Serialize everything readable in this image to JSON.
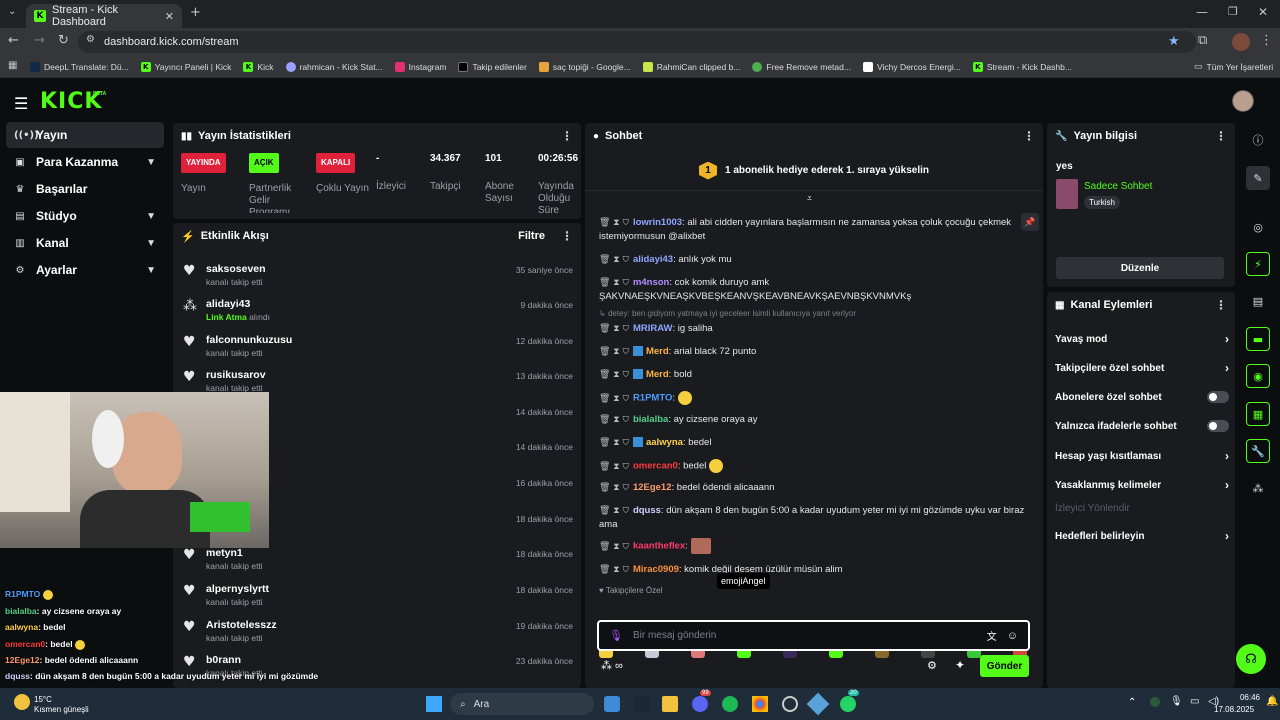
{
  "browser": {
    "tab_title": "Stream - Kick Dashboard",
    "url": "dashboard.kick.com/stream",
    "bookmarks": [
      "DeepL Translate: Dü...",
      "Yayıncı Paneli | Kick",
      "Kick",
      "rahmican - Kick Stat...",
      "Instagram",
      "Takip edilenler",
      "saç topiği - Google...",
      "RahmiCan clipped b...",
      "Free Remove metad...",
      "Vichy Dercos Energi...",
      "Stream - Kick Dashb..."
    ],
    "all_bookmarks": "Tüm Yer İşaretleri"
  },
  "logo": "KICK",
  "logo_sup": "BETA",
  "sidebar": {
    "items": [
      {
        "label": "Yayın",
        "icon": "broadcast-icon"
      },
      {
        "label": "Para Kazanma",
        "icon": "wallet-icon"
      },
      {
        "label": "Başarılar",
        "icon": "trophy-icon"
      },
      {
        "label": "Stüdyo",
        "icon": "studio-icon"
      },
      {
        "label": "Kanal",
        "icon": "channel-icon"
      },
      {
        "label": "Ayarlar",
        "icon": "gear-icon"
      }
    ]
  },
  "stats": {
    "title": "Yayın İstatistikleri",
    "items": [
      {
        "badge": "YAYINDA",
        "label": "Yayın"
      },
      {
        "badge": "AÇIK",
        "label": "Partnerlik Gelir Programı"
      },
      {
        "badge": "KAPALI",
        "label": "Çoklu Yayın"
      },
      {
        "value": "-",
        "label": "İzleyici"
      },
      {
        "value": "34.367",
        "label": "Takipçi"
      },
      {
        "value": "101",
        "label": "Abone Sayısı"
      },
      {
        "value": "00:26:56",
        "label": "Yayında Olduğu Süre"
      }
    ]
  },
  "activity": {
    "title": "Etkinlik Akışı",
    "filter": "Filtre",
    "rows": [
      {
        "name": "saksoseven",
        "sub": "kanalı takip etti",
        "time": "35 saniye önce"
      },
      {
        "name": "alidayi43",
        "sub_green": "Link Atma",
        "sub": "alındı",
        "time": "9 dakika önce"
      },
      {
        "name": "falconnunkuzusu",
        "sub": "kanalı takip etti",
        "time": "12 dakika önce"
      },
      {
        "name": "rusikusarov",
        "sub": "kanalı takip etti",
        "time": "13 dakika önce"
      },
      {
        "name": "",
        "sub": "",
        "time": "14 dakika önce"
      },
      {
        "name": "c",
        "sub": "",
        "time": "14 dakika önce"
      },
      {
        "name": "",
        "sub": "",
        "time": "16 dakika önce"
      },
      {
        "name": "",
        "sub": "",
        "time": "18 dakika önce"
      },
      {
        "name": "metyn1",
        "sub": "kanalı takip etti",
        "time": "18 dakika önce"
      },
      {
        "name": "alpernyslyrtt",
        "sub": "kanalı takip etti",
        "time": "18 dakika önce"
      },
      {
        "name": "Aristotelesszz",
        "sub": "kanalı takip etti",
        "time": "19 dakika önce"
      },
      {
        "name": "b0rann",
        "sub": "kanalı takip etti",
        "time": "23 dakika önce"
      }
    ]
  },
  "chat": {
    "title": "Sohbet",
    "gift_count": "1",
    "gift_text": "1 abonelik hediye ederek 1. sıraya yükselin",
    "reply_note": "detey: ben gidiyom yatmaya iyi geceleer lsimli kullanıcıya yanıt verlyor",
    "messages": [
      {
        "user": "lowrin1003",
        "color": "#8fa6ff",
        "text": "ali abi cidden yayınlara başlarmısın ne zamansa yoksa çoluk çocuğu çekmek istemiyormusun @alixbet"
      },
      {
        "user": "alidayi43",
        "color": "#8fa6ff",
        "text": "anlık yok mu"
      },
      {
        "user": "m4nson",
        "color": "#b48cff",
        "text": "cok komik duruyo amk ŞAKVNAEŞKVNEAŞKVBEŞKEANVŞKEAVBNEAVKŞAEVNBŞKVNMVKş"
      },
      {
        "user": "MRIRAW",
        "color": "#8fa6ff",
        "text": "ig saliha"
      },
      {
        "user": "Merd",
        "color": "#ffb347",
        "text": "arial black 72 punto"
      },
      {
        "user": "Merd",
        "color": "#ffb347",
        "text": "bold"
      },
      {
        "user": "R1PMTO",
        "color": "#4d9dff",
        "text": ""
      },
      {
        "user": "bialalba",
        "color": "#53d18a",
        "text": "ay cizsene oraya ay"
      },
      {
        "user": "aalwyna",
        "color": "#ffd24d",
        "text": "bedel"
      },
      {
        "user": "omercan0",
        "color": "#ff3b3b",
        "text": "bedel"
      },
      {
        "user": "12Ege12",
        "color": "#ff9a6b",
        "text": "bedel ödendi alicaaann"
      },
      {
        "user": "dquss",
        "color": "#d0d0ff",
        "text": "dün akşam 8 den bugün 5:00 a kadar uyudum yeter mi iyi mi gözümde uyku var biraz ama"
      },
      {
        "user": "kaantheflex",
        "color": "#ff3b6b",
        "text": ""
      },
      {
        "user": "Mirac0909",
        "color": "#ff8f3b",
        "text": "komik değil desem üzülür müsün alim"
      }
    ],
    "followers_only": "Takipçilere Özel",
    "tooltip": "emojiAngel",
    "placeholder": "Bir mesaj gönderin",
    "send": "Gönder"
  },
  "stream_info": {
    "title": "Yayın bilgisi",
    "stream_title": "yes",
    "category": "Sadece Sohbet",
    "tag": "Turkish",
    "edit": "Düzenle"
  },
  "channel_actions": {
    "title": "Kanal Eylemleri",
    "items": [
      {
        "label": "Yavaş mod",
        "type": "arrow"
      },
      {
        "label": "Takipçilere özel sohbet",
        "type": "arrow"
      },
      {
        "label": "Abonelere özel sohbet",
        "type": "toggle"
      },
      {
        "label": "Yalnızca ifadelerle sohbet",
        "type": "toggle"
      },
      {
        "label": "Hesap yaşı kısıtlaması",
        "type": "arrow"
      },
      {
        "label": "Yasaklanmış kelimeler",
        "type": "arrow"
      },
      {
        "label": "İzleyici Yönlendir",
        "type": "disabled"
      },
      {
        "label": "Hedefleri belirleyin",
        "type": "arrow"
      }
    ]
  },
  "overlay_chat": [
    {
      "user": "R1PMTO",
      "color": "#4d9dff",
      "text": ""
    },
    {
      "user": "bialalba",
      "color": "#53d18a",
      "text": ": ay cizsene oraya ay"
    },
    {
      "user": "aalwyna",
      "color": "#ffd24d",
      "text": ": bedel"
    },
    {
      "user": "omercan0",
      "color": "#ff3b3b",
      "text": ": bedel"
    },
    {
      "user": "12Ege12",
      "color": "#ff9a6b",
      "text": ": bedel ödendi alicaaann"
    },
    {
      "user": "dquss",
      "color": "#d0d0ff",
      "text": ": dün akşam 8 den bugün 5:00 a kadar uyudum yeter mi iyi mi gözümde"
    },
    {
      "user": "kaantheflex",
      "color": "#ff3b6b",
      "text": ""
    }
  ],
  "taskbar": {
    "weather_temp": "15°C",
    "weather_text": "Kısmen güneşli",
    "search": "Ara",
    "time": "06:46",
    "date": "17.08.2025",
    "badge1": "99",
    "badge2": "20"
  }
}
